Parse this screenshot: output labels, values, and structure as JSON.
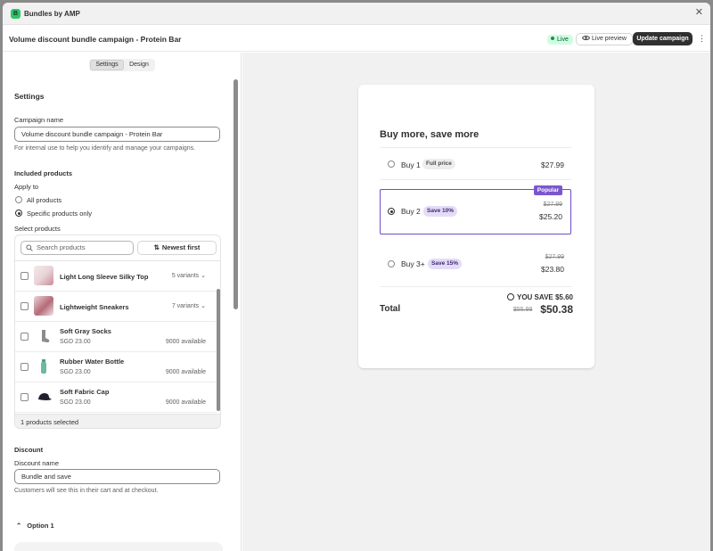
{
  "app": {
    "logo_letter": "B",
    "title": "Bundles by AMP"
  },
  "header": {
    "page_title": "Volume discount bundle campaign - Protein Bar",
    "status": "Live",
    "preview_label": "Live preview",
    "update_label": "Update campaign"
  },
  "tabs": [
    "Settings",
    "Design"
  ],
  "settings": {
    "heading": "Settings",
    "campaign_name_label": "Campaign name",
    "campaign_name_value": "Volume discount bundle campaign - Protein Bar",
    "campaign_name_help": "For internal use to help you identify and manage your campaigns.",
    "included_products_heading": "Included products",
    "apply_to_label": "Apply to",
    "apply_options": [
      "All products",
      "Specific products only"
    ],
    "apply_selected": "Specific products only",
    "select_products_label": "Select products",
    "search_placeholder": "Search products",
    "sort_label": "Newest first",
    "products": [
      {
        "name": "Light Long Sleeve Silky Top",
        "right": "5 variants",
        "sub": ""
      },
      {
        "name": "Lightweight Sneakers",
        "right": "7 variants",
        "sub": ""
      },
      {
        "name": "Soft Gray Socks",
        "sub": "SGD 23.00",
        "right": "9000 available"
      },
      {
        "name": "Rubber Water Bottle",
        "sub": "SGD 23.00",
        "right": "9000 available"
      },
      {
        "name": "Soft Fabric Cap",
        "sub": "SGD 23.00",
        "right": "9000 available"
      }
    ],
    "selected_count": "1 products selected",
    "discount_heading": "Discount",
    "discount_name_label": "Discount name",
    "discount_name_value": "Bundle and save",
    "discount_help": "Customers will see this in their cart and at checkout.",
    "option_label": "Option 1"
  },
  "preview": {
    "title": "Buy more, save more",
    "tiers": [
      {
        "name": "Buy 1",
        "tag": "Full price",
        "price": "$27.99",
        "old_price": ""
      },
      {
        "name": "Buy 2",
        "tag": "Save 10%",
        "price": "$25.20",
        "old_price": "$27.99",
        "badge": "Popular"
      },
      {
        "name": "Buy 3+",
        "tag": "Save 15%",
        "price": "$23.80",
        "old_price": "$27.99"
      }
    ],
    "you_save": "YOU SAVE $5.60",
    "total_label": "Total",
    "total_old": "$55.98",
    "total_new": "$50.38"
  },
  "colors": {
    "accent_purple": "#6f4cc4",
    "live_green": "#cdfee1",
    "primary_dark": "#303030"
  }
}
